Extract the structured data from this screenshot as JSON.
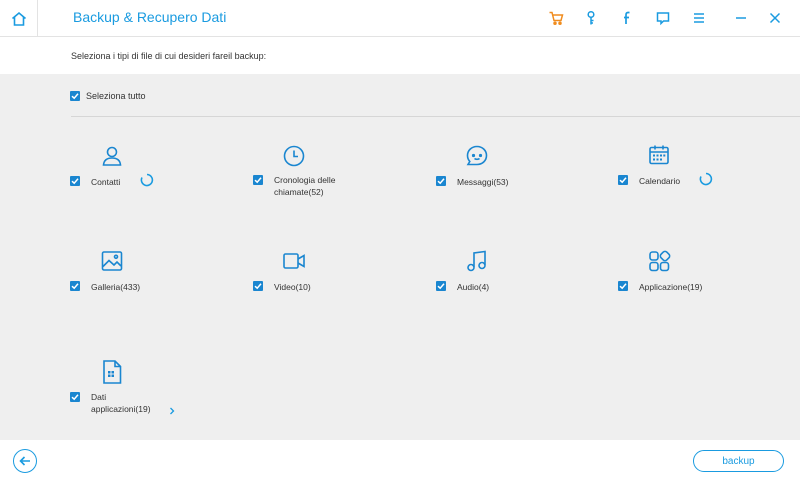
{
  "window": {
    "title": "Backup & Recupero Dati",
    "icons": [
      "home-icon",
      "cart-icon",
      "key-icon",
      "facebook-icon",
      "feedback-icon",
      "menu-icon",
      "minimize-icon",
      "close-icon"
    ]
  },
  "subtitle": "Seleziona i tipi di file di cui desideri fareil backup:",
  "select_all": {
    "label": "Seleziona tutto",
    "checked": true
  },
  "items": [
    {
      "label": "Contatti",
      "icon": "contacts-icon",
      "checked": true,
      "loading": true
    },
    {
      "label": "Cronologia delle chiamate(52)",
      "icon": "clock-icon",
      "checked": true,
      "loading": false
    },
    {
      "label": "Messaggi(53)",
      "icon": "message-icon",
      "checked": true,
      "loading": false
    },
    {
      "label": "Calendario",
      "icon": "calendar-icon",
      "checked": true,
      "loading": true
    },
    {
      "label": "Galleria(433)",
      "icon": "image-icon",
      "checked": true,
      "loading": false
    },
    {
      "label": "Video(10)",
      "icon": "video-icon",
      "checked": true,
      "loading": false
    },
    {
      "label": "Audio(4)",
      "icon": "music-icon",
      "checked": true,
      "loading": false
    },
    {
      "label": "Applicazione(19)",
      "icon": "apps-icon",
      "checked": true,
      "loading": false
    },
    {
      "label": "Dati applicazioni(19)",
      "icon": "app-data-icon",
      "checked": true,
      "loading": false
    }
  ],
  "footer": {
    "backup_label": "backup",
    "back_icon": "back-arrow-icon"
  },
  "colors": {
    "accent": "#1a9be0",
    "checkbox": "#1a86d0",
    "orange": "#f08c1e",
    "panel": "#efefef"
  }
}
